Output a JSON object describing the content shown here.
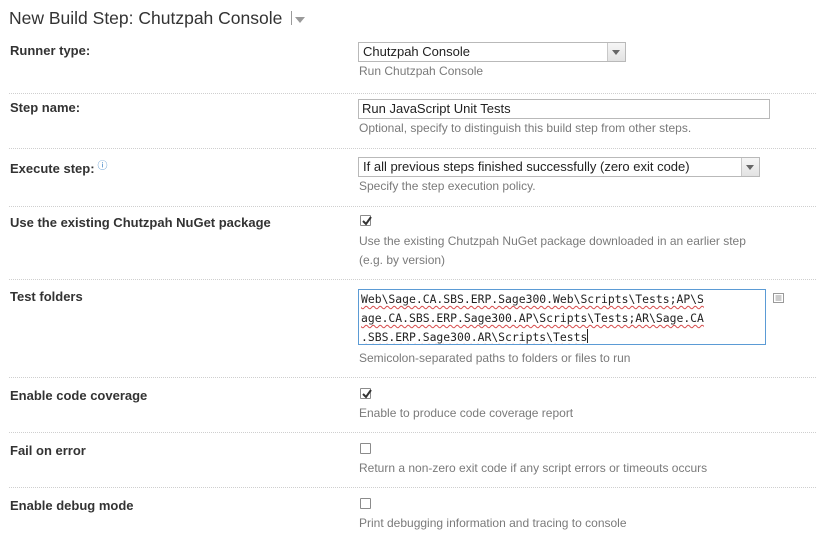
{
  "header": {
    "title": "New Build Step: Chutzpah Console"
  },
  "runner_type": {
    "label": "Runner type:",
    "value": "Chutzpah Console",
    "hint": "Run Chutzpah Console"
  },
  "step_name": {
    "label": "Step name:",
    "value": "Run JavaScript Unit Tests",
    "hint": "Optional, specify to distinguish this build step from other steps."
  },
  "execute_step": {
    "label": "Execute step:",
    "value": "If all previous steps finished successfully (zero exit code)",
    "hint": "Specify the step execution policy."
  },
  "use_existing_package": {
    "label": "Use the existing Chutzpah NuGet package",
    "checked": true,
    "hint_line1": "Use the existing Chutzpah NuGet package downloaded in an earlier step",
    "hint_line2": "(e.g. by version)"
  },
  "test_folders": {
    "label": "Test folders",
    "lines": [
      "Web\\Sage.CA.SBS.ERP.Sage300.Web\\Scripts\\Tests;AP\\S",
      "age.CA.SBS.ERP.Sage300.AP\\Scripts\\Tests;AR\\Sage.CA",
      ".SBS.ERP.Sage300.AR\\Scripts\\Tests"
    ],
    "hint": "Semicolon-separated paths to folders or files to run"
  },
  "enable_code_coverage": {
    "label": "Enable code coverage",
    "checked": true,
    "hint": "Enable to produce code coverage report"
  },
  "fail_on_error": {
    "label": "Fail on error",
    "checked": false,
    "hint": "Return a non-zero exit code if any script errors or timeouts occurs"
  },
  "enable_debug_mode": {
    "label": "Enable debug mode",
    "checked": false,
    "hint": "Print debugging information and tracing to console"
  },
  "icons": {
    "help": "question-circle-icon",
    "expand": "text-expand-icon",
    "title_menu": "chevron-down-icon"
  },
  "colors": {
    "accent": "#3f84c6",
    "focus_border": "#5b9bd5",
    "hint_text": "#7a7a7a"
  }
}
